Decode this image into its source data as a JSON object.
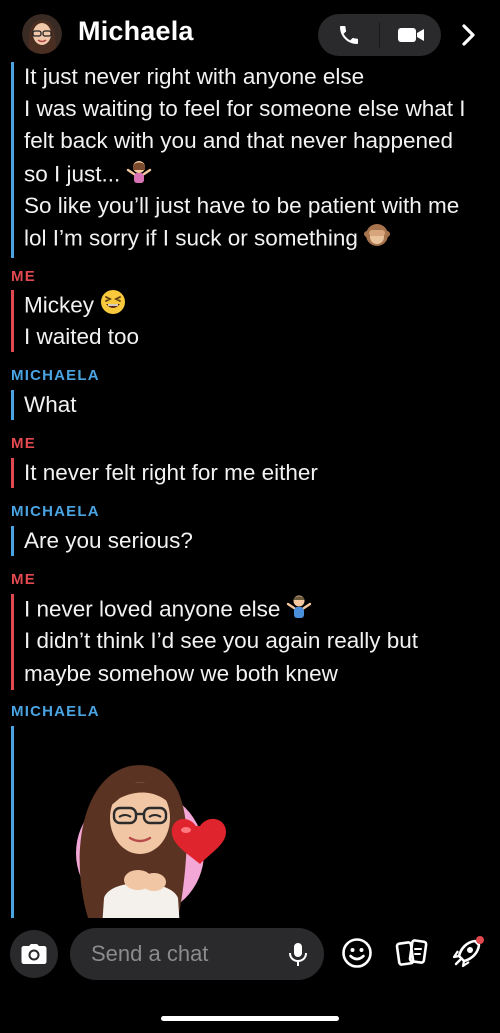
{
  "header": {
    "title": "Michaela"
  },
  "messages": [
    {
      "sender": "",
      "lines": [
        "It just never right with anyone else",
        "I was waiting to feel for someone else what I",
        "felt back with you and that never happened",
        "so I just...",
        "So like you’ll just have to be patient with me",
        "lol I’m sorry if I suck or something"
      ]
    },
    {
      "sender": "ME",
      "lines": [
        "Mickey",
        "I waited too"
      ]
    },
    {
      "sender": "MICHAELA",
      "lines": [
        "What"
      ]
    },
    {
      "sender": "ME",
      "lines": [
        "It never felt right for me either"
      ]
    },
    {
      "sender": "MICHAELA",
      "lines": [
        "Are you serious?"
      ]
    },
    {
      "sender": "ME",
      "lines": [
        "I never loved anyone else",
        "I didn’t think I’d see you again really but",
        "maybe somehow we both knew"
      ]
    },
    {
      "sender": "MICHAELA",
      "lines": []
    }
  ],
  "input": {
    "placeholder": "Send a chat"
  },
  "icons": {
    "call": "phone-icon",
    "video": "video-camera-icon",
    "forward": "chevron-right-icon",
    "camera": "camera-icon",
    "mic": "microphone-icon",
    "emoji": "smiley-icon",
    "stickers": "cards-icon",
    "rocket": "rocket-icon"
  },
  "colors": {
    "me": "#e2484f",
    "michaela": "#4aa4e3",
    "background": "#000000",
    "pill": "#2a2a2c"
  }
}
